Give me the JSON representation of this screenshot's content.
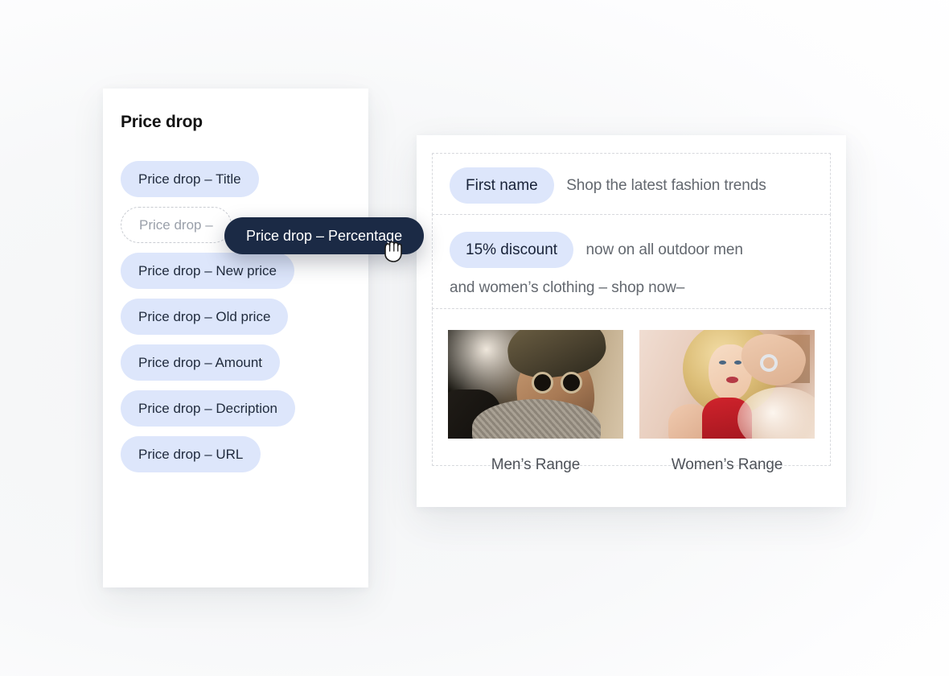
{
  "left_panel": {
    "title": "Price drop",
    "items": [
      {
        "label": "Price drop – Title",
        "state": "chip"
      },
      {
        "label": "Price drop –",
        "state": "placeholder"
      },
      {
        "label": "Price drop – New price",
        "state": "chip"
      },
      {
        "label": "Price drop – Old price",
        "state": "chip"
      },
      {
        "label": "Price drop – Amount",
        "state": "chip"
      },
      {
        "label": "Price drop – Decription",
        "state": "chip"
      },
      {
        "label": "Price drop – URL",
        "state": "chip"
      }
    ]
  },
  "drag": {
    "chip_label": "Price drop – Percentage",
    "cursor": "grabbing-hand-cursor"
  },
  "right_panel": {
    "sections": [
      {
        "token": "First name",
        "text": "Shop the latest fashion trends"
      },
      {
        "token": "15% discount",
        "text": "now on all outdoor men",
        "text_line2": "and women’s clothing – shop now–"
      }
    ],
    "cards": [
      {
        "label": "Men’s Range",
        "image": "man-wearing-beanie-and-sunglasses-photo"
      },
      {
        "label": "Women’s Range",
        "image": "blonde-woman-in-red-dress-photo"
      }
    ]
  },
  "colors": {
    "chip_bg": "#dde6fb",
    "chip_text": "#1f2a3c",
    "drag_chip_bg": "#1b2a45",
    "drag_chip_text": "#ffffff",
    "placeholder_border": "#c9ccd2",
    "placeholder_text": "#9aa0aa",
    "body_text": "#63686f",
    "panel_bg": "#ffffff",
    "dashed_border": "#d7d9dd"
  }
}
